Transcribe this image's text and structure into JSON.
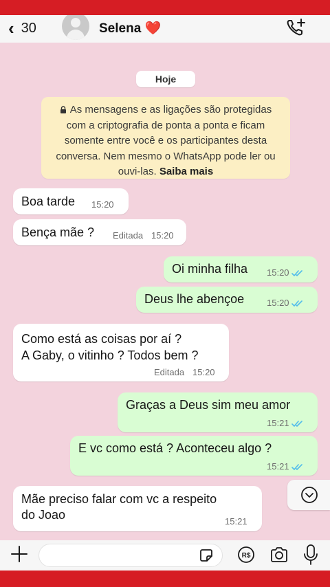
{
  "header": {
    "back_count": "30",
    "contact_name": "Selena ❤️"
  },
  "chat": {
    "day_label": "Hoje",
    "notice_text": "As mensagens e as ligações são protegidas com a criptografia de ponta a ponta e ficam somente entre você e os participantes desta conversa. Nem mesmo o WhatsApp pode ler ou ouvi-las.",
    "notice_link": "Saiba mais",
    "messages": [
      {
        "direction": "in",
        "text": "Boa tarde",
        "time": "15:20",
        "edited": ""
      },
      {
        "direction": "in",
        "text": "Bença mãe ?",
        "time": "15:20",
        "edited": "Editada"
      },
      {
        "direction": "out",
        "text": "Oi minha filha",
        "time": "15:20",
        "edited": "",
        "read": true
      },
      {
        "direction": "out",
        "text": "Deus lhe abençoe",
        "time": "15:20",
        "edited": "",
        "read": true
      },
      {
        "direction": "in",
        "text": "Como está as coisas por aí ?\nA Gaby, o vitinho ? Todos bem ?",
        "time": "15:20",
        "edited": "Editada"
      },
      {
        "direction": "out",
        "text": "Graças a Deus sim meu amor",
        "time": "15:21",
        "edited": "",
        "read": true
      },
      {
        "direction": "out",
        "text": "E vc como está ? Aconteceu algo ?",
        "time": "15:21",
        "edited": "",
        "read": true
      },
      {
        "direction": "in",
        "text": "Mãe preciso falar com vc a respeito\ndo Joao",
        "time": "15:21",
        "edited": ""
      }
    ]
  },
  "input": {
    "placeholder": ""
  },
  "colors": {
    "chat_background": "#f3d3dd",
    "outgoing_bubble": "#d9fdd3",
    "incoming_bubble": "#ffffff",
    "notice_background": "#fcefc4",
    "read_ticks": "#53bdeb",
    "frame_red": "#d61d24"
  },
  "icons": [
    "chevron-left-icon",
    "avatar-placeholder-icon",
    "add-call-icon",
    "lock-icon",
    "double-check-icon",
    "chevron-down-icon",
    "plus-icon",
    "sticker-icon",
    "payment-icon",
    "camera-icon",
    "microphone-icon"
  ]
}
